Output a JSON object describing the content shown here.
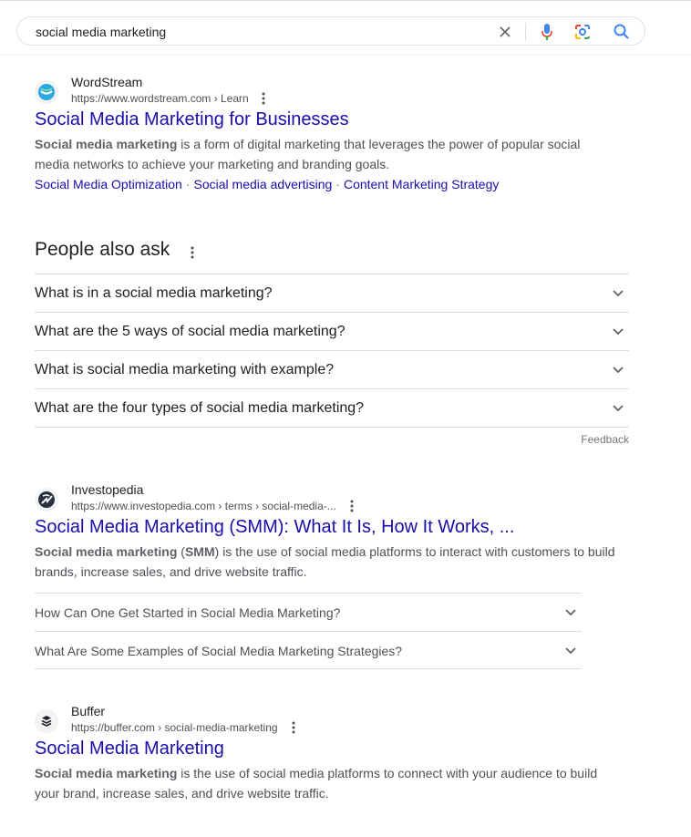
{
  "search": {
    "query": "social media marketing"
  },
  "results": [
    {
      "site_name": "WordStream",
      "url": "https://www.wordstream.com › Learn",
      "title": "Social Media Marketing for Businesses",
      "snippet_bold": "Social media marketing",
      "snippet_rest": " is a form of digital marketing that leverages the power of popular social media networks to achieve your marketing and branding goals.",
      "sitelinks": [
        "Social Media Optimization",
        "Social media advertising",
        "Content Marketing Strategy"
      ]
    },
    {
      "site_name": "Investopedia",
      "url": "https://www.investopedia.com › terms › social-media-...",
      "title": "Social Media Marketing (SMM): What It Is, How It Works, ...",
      "snippet_bold": "Social media marketing",
      "snippet_mid": " (",
      "snippet_bold2": "SMM",
      "snippet_rest": ") is the use of social media platforms to interact with customers to build brands, increase sales, and drive website traffic.",
      "sub_questions": [
        "How Can One Get Started in Social Media Marketing?",
        "What Are Some Examples of Social Media Marketing Strategies?"
      ]
    },
    {
      "site_name": "Buffer",
      "url": "https://buffer.com › social-media-marketing",
      "title": "Social Media Marketing",
      "snippet_bold": "Social media marketing",
      "snippet_rest": " is the use of social media platforms to connect with your audience to build your brand, increase sales, and drive website traffic."
    }
  ],
  "people_also_ask": {
    "heading": "People also ask",
    "questions": [
      "What is in a social media marketing?",
      "What are the 5 ways of social media marketing?",
      "What is social media marketing with example?",
      "What are the four types of social media marketing?"
    ],
    "feedback": "Feedback"
  },
  "colors": {
    "link": "#1a0dab",
    "text": "#202124",
    "snippet": "#4d5156",
    "border": "#dadce0",
    "search_blue": "#4285f4"
  }
}
